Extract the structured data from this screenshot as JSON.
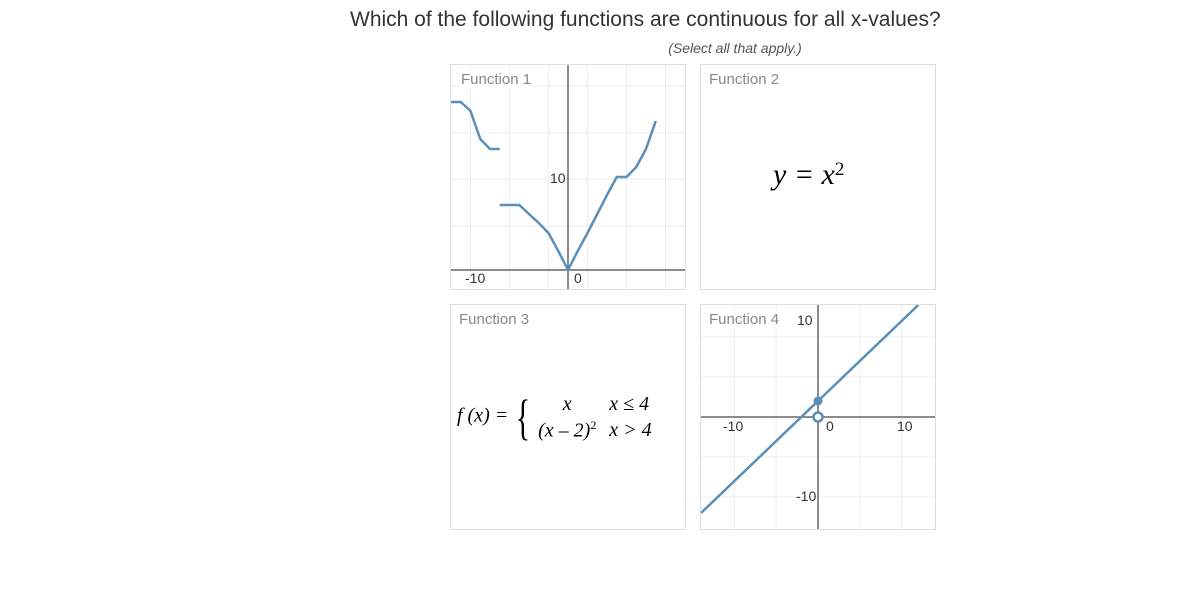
{
  "question": "Which of the following functions are continuous for all x-values?",
  "instruction": "(Select all that apply.)",
  "cards": {
    "c1": {
      "label": "Function 1"
    },
    "c2": {
      "label": "Function 2",
      "formula_html": "y = x<span class='sup'>2</span>"
    },
    "c3": {
      "label": "Function 3",
      "lhs": "f (x) = ",
      "row1_expr": "x",
      "row1_cond": "x ≤ 4",
      "row2_expr_html": "(x – 2)<span class='sup'>2</span>",
      "row2_cond": "x > 4"
    },
    "c4": {
      "label": "Function 4"
    }
  },
  "chart_data": [
    {
      "id": "function1",
      "type": "line",
      "xlim": [
        -12,
        12
      ],
      "ylim": [
        -2,
        22
      ],
      "xticks": [
        -10,
        0
      ],
      "yticks": [
        0,
        10
      ],
      "segments": [
        {
          "points": [
            [
              -12,
              18
            ],
            [
              -11,
              18
            ],
            [
              -10,
              17
            ],
            [
              -9,
              14
            ],
            [
              -8,
              13
            ],
            [
              -7,
              13
            ]
          ]
        },
        {
          "points": [
            [
              -7,
              7
            ],
            [
              -6,
              7
            ],
            [
              -5,
              7
            ],
            [
              -4,
              6
            ],
            [
              -3,
              5
            ],
            [
              -2,
              4
            ],
            [
              -1,
              2
            ],
            [
              0,
              0
            ],
            [
              1,
              2
            ],
            [
              2,
              4
            ],
            [
              3,
              6
            ],
            [
              4,
              8
            ],
            [
              5,
              10
            ],
            [
              6,
              10
            ],
            [
              7,
              11
            ],
            [
              8,
              13
            ],
            [
              9,
              16
            ]
          ]
        }
      ]
    },
    {
      "id": "function4",
      "type": "line",
      "xlim": [
        -14,
        14
      ],
      "ylim": [
        -14,
        14
      ],
      "xticks": [
        -10,
        0,
        10
      ],
      "yticks": [
        -10,
        10
      ],
      "line": {
        "slope": 1,
        "intercept": 2,
        "x_from": -14,
        "x_to": 12
      },
      "open_point": [
        0,
        0
      ],
      "closed_point": [
        0,
        2
      ]
    }
  ]
}
